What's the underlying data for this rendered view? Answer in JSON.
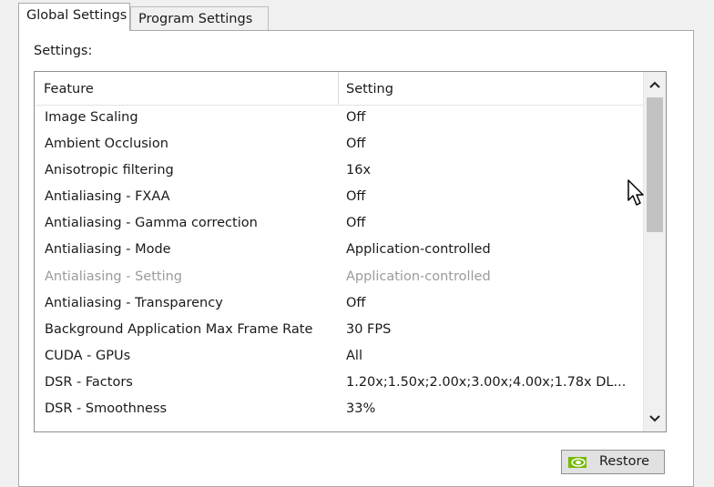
{
  "tabs": [
    {
      "label": "Global Settings",
      "active": true
    },
    {
      "label": "Program Settings",
      "active": false
    }
  ],
  "settings_label": "Settings:",
  "columns": {
    "feature": "Feature",
    "setting": "Setting"
  },
  "rows": [
    {
      "feature": "Image Scaling",
      "setting": "Off",
      "disabled": false
    },
    {
      "feature": "Ambient Occlusion",
      "setting": "Off",
      "disabled": false
    },
    {
      "feature": "Anisotropic filtering",
      "setting": "16x",
      "disabled": false
    },
    {
      "feature": "Antialiasing - FXAA",
      "setting": "Off",
      "disabled": false
    },
    {
      "feature": "Antialiasing - Gamma correction",
      "setting": "Off",
      "disabled": false
    },
    {
      "feature": "Antialiasing - Mode",
      "setting": "Application-controlled",
      "disabled": false
    },
    {
      "feature": "Antialiasing - Setting",
      "setting": "Application-controlled",
      "disabled": true
    },
    {
      "feature": "Antialiasing - Transparency",
      "setting": "Off",
      "disabled": false
    },
    {
      "feature": "Background Application Max Frame Rate",
      "setting": "30 FPS",
      "disabled": false
    },
    {
      "feature": "CUDA - GPUs",
      "setting": "All",
      "disabled": false
    },
    {
      "feature": "DSR - Factors",
      "setting": "1.20x;1.50x;2.00x;3.00x;4.00x;1.78x DL...",
      "disabled": false
    },
    {
      "feature": "DSR - Smoothness",
      "setting": "33%",
      "disabled": false
    }
  ],
  "icons": {
    "scroll_up": "chevron-up-icon",
    "scroll_down": "chevron-down-icon",
    "restore_logo": "nvidia-logo-icon",
    "cursor": "mouse-cursor-icon"
  },
  "restore_button": {
    "label": "Restore"
  },
  "colors": {
    "logo_green": "#76b900",
    "disabled_text": "#9b9b9b"
  }
}
